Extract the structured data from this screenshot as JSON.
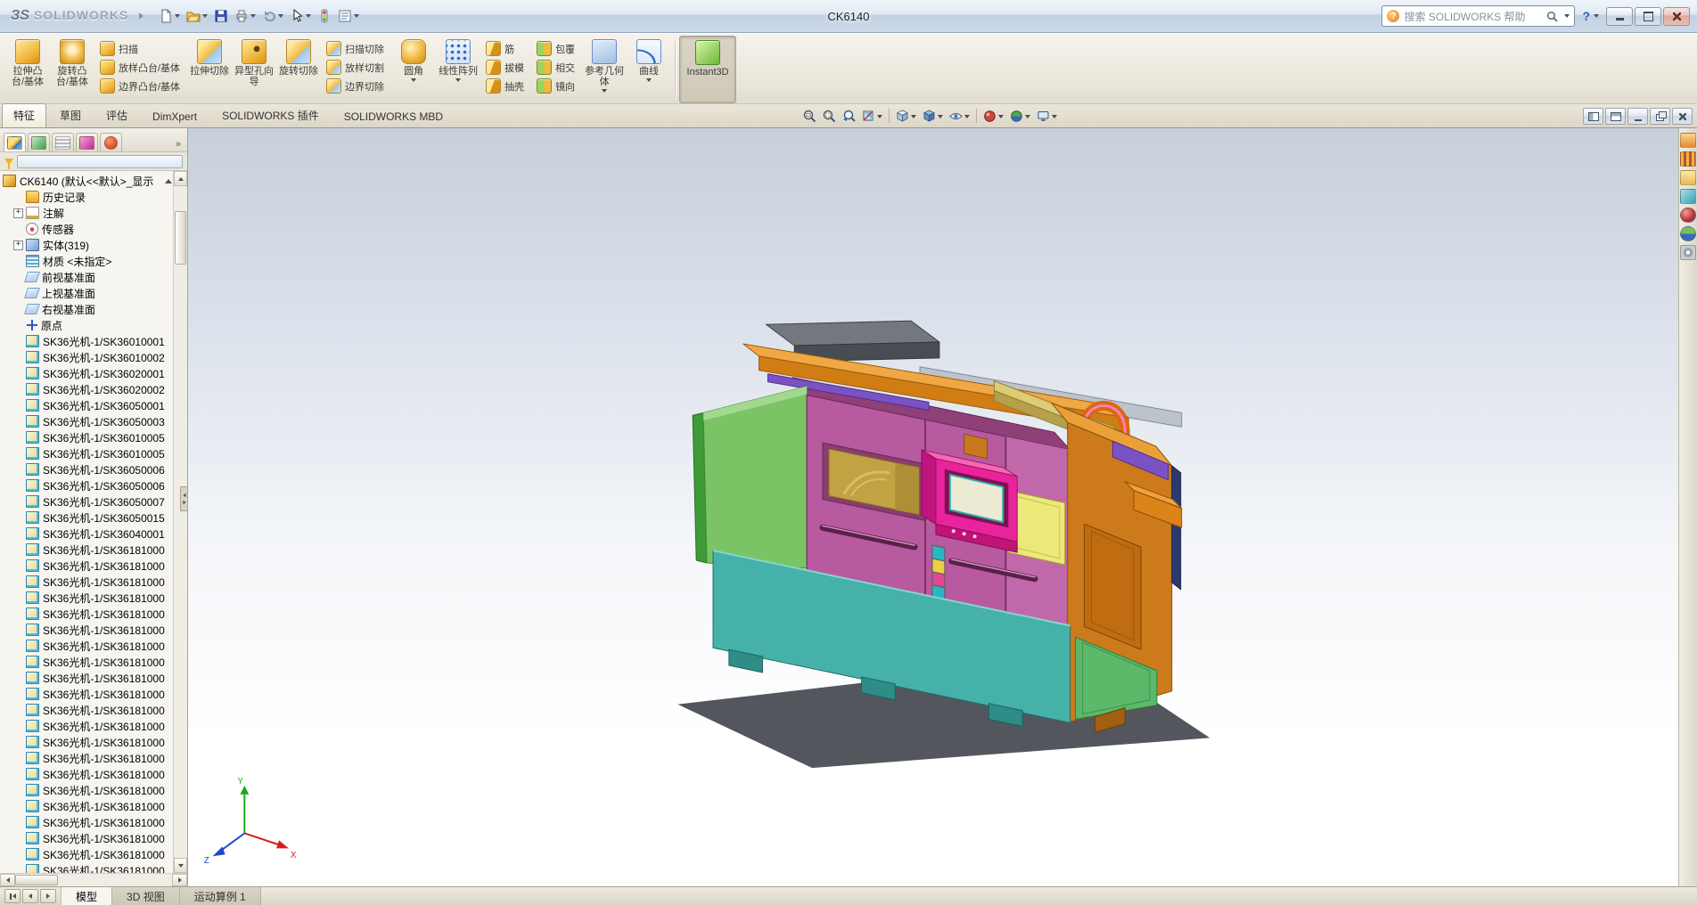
{
  "window": {
    "brand_mark": "ЗS",
    "brand_name": "SOLIDWORKS",
    "title": "CK6140"
  },
  "titlebar": {
    "search_placeholder": "搜索 SOLIDWORKS 帮助",
    "help_glyph": "?",
    "window_icons": [
      "minimize",
      "maximize",
      "close"
    ]
  },
  "quickbar": {
    "icons": [
      "new",
      "open",
      "save",
      "print",
      "undo",
      "select",
      "rebuild",
      "file-properties"
    ]
  },
  "ribbon": {
    "tabs": [
      {
        "label": "特征",
        "active": true
      },
      {
        "label": "草图"
      },
      {
        "label": "评估"
      },
      {
        "label": "DimXpert"
      },
      {
        "label": "SOLIDWORKS 插件"
      },
      {
        "label": "SOLIDWORKS MBD"
      }
    ],
    "large": [
      {
        "label": "拉伸凸台/基体",
        "icon": "extrude-boss"
      },
      {
        "label": "旋转凸台/基体",
        "icon": "revolve-boss"
      },
      {
        "label": "拉伸切除",
        "icon": "extrude-cut"
      },
      {
        "label": "异型孔向导",
        "icon": "hole-wizard"
      },
      {
        "label": "旋转切除",
        "icon": "revolve-cut"
      },
      {
        "label": "圆角",
        "icon": "fillet",
        "dd": true
      },
      {
        "label": "线性阵列",
        "icon": "linear-pattern",
        "dd": true
      },
      {
        "label": "参考几何体",
        "icon": "reference-geometry",
        "dd": true
      },
      {
        "label": "曲线",
        "icon": "curves",
        "dd": true
      },
      {
        "label": "Instant3D",
        "icon": "instant3d",
        "pressed": true
      }
    ],
    "col1": [
      "扫描",
      "放样凸台/基体",
      "边界凸台/基体"
    ],
    "col2": [
      "扫描切除",
      "放样切割",
      "边界切除"
    ],
    "col3": [
      "筋",
      "拔模",
      "抽壳"
    ],
    "col4": [
      "包覆",
      "相交",
      "镜向"
    ]
  },
  "viewbar": {
    "icons": [
      "zoom-fit",
      "zoom-area",
      "previous-view",
      "section-view",
      "view-orientation",
      "display-style",
      "hide-show-items",
      "edit-appearance",
      "apply-scene",
      "view-settings"
    ]
  },
  "pm": {
    "header_icons": [
      "featuremanager-tree",
      "propertymanager",
      "configurationmanager",
      "dimxpertmanager",
      "displaymanager"
    ],
    "overflow_glyph": "»",
    "root": {
      "label": "CK6140 (默认<<默认>_显示"
    },
    "items": [
      {
        "icon": "history",
        "label": "历史记录"
      },
      {
        "icon": "annotations",
        "label": "注解",
        "expand": "+"
      },
      {
        "icon": "sensors",
        "label": "传感器"
      },
      {
        "icon": "bodies",
        "label": "实体(319)",
        "expand": "+"
      },
      {
        "icon": "material",
        "label": "材质 <未指定>"
      },
      {
        "icon": "plane",
        "label": "前视基准面"
      },
      {
        "icon": "plane",
        "label": "上视基准面"
      },
      {
        "icon": "plane",
        "label": "右视基准面"
      },
      {
        "icon": "origin",
        "label": "原点"
      },
      {
        "icon": "body",
        "label": "SK36光机-1/SK36010001"
      },
      {
        "icon": "body",
        "label": "SK36光机-1/SK36010002"
      },
      {
        "icon": "body",
        "label": "SK36光机-1/SK36020001"
      },
      {
        "icon": "body",
        "label": "SK36光机-1/SK36020002"
      },
      {
        "icon": "body",
        "label": "SK36光机-1/SK36050001"
      },
      {
        "icon": "body",
        "label": "SK36光机-1/SK36050003"
      },
      {
        "icon": "body",
        "label": "SK36光机-1/SK36010005"
      },
      {
        "icon": "body",
        "label": "SK36光机-1/SK36010005"
      },
      {
        "icon": "body",
        "label": "SK36光机-1/SK36050006"
      },
      {
        "icon": "body",
        "label": "SK36光机-1/SK36050006"
      },
      {
        "icon": "body",
        "label": "SK36光机-1/SK36050007"
      },
      {
        "icon": "body",
        "label": "SK36光机-1/SK36050015"
      },
      {
        "icon": "body",
        "label": "SK36光机-1/SK36040001"
      },
      {
        "icon": "body",
        "label": "SK36光机-1/SK36181000"
      },
      {
        "icon": "body",
        "label": "SK36光机-1/SK36181000"
      },
      {
        "icon": "body",
        "label": "SK36光机-1/SK36181000"
      },
      {
        "icon": "body",
        "label": "SK36光机-1/SK36181000"
      },
      {
        "icon": "body",
        "label": "SK36光机-1/SK36181000"
      },
      {
        "icon": "body",
        "label": "SK36光机-1/SK36181000"
      },
      {
        "icon": "body",
        "label": "SK36光机-1/SK36181000"
      },
      {
        "icon": "body",
        "label": "SK36光机-1/SK36181000"
      },
      {
        "icon": "body",
        "label": "SK36光机-1/SK36181000"
      },
      {
        "icon": "body",
        "label": "SK36光机-1/SK36181000"
      },
      {
        "icon": "body",
        "label": "SK36光机-1/SK36181000"
      },
      {
        "icon": "body",
        "label": "SK36光机-1/SK36181000"
      },
      {
        "icon": "body",
        "label": "SK36光机-1/SK36181000"
      },
      {
        "icon": "body",
        "label": "SK36光机-1/SK36181000"
      },
      {
        "icon": "body",
        "label": "SK36光机-1/SK36181000"
      },
      {
        "icon": "body",
        "label": "SK36光机-1/SK36181000"
      },
      {
        "icon": "body",
        "label": "SK36光机-1/SK36181000"
      },
      {
        "icon": "body",
        "label": "SK36光机-1/SK36181000"
      },
      {
        "icon": "body",
        "label": "SK36光机-1/SK36181000"
      },
      {
        "icon": "body",
        "label": "SK36光机-1/SK36181000"
      },
      {
        "icon": "body",
        "label": "SK36光机-1/SK36181000"
      }
    ]
  },
  "docbar": {
    "tabs": [
      {
        "label": "模型",
        "active": true
      },
      {
        "label": "3D 视图"
      },
      {
        "label": "运动算例 1"
      }
    ]
  },
  "taskpane": {
    "icons": [
      "solidworks-resources",
      "design-library",
      "file-explorer",
      "view-palette",
      "appearances",
      "scenes",
      "custom-properties"
    ]
  },
  "viewport": {
    "triad": {
      "x": "X",
      "y": "Y",
      "z": "Z"
    }
  },
  "colors": {
    "machine_teal": "#46B1A9",
    "machine_green": "#7AC465",
    "machine_magenta": "#B85AA0",
    "machine_orange": "#CD7A1C",
    "machine_pink": "#E9239B",
    "machine_yellow": "#ECE87A",
    "machine_violet": "#7B52C4",
    "viewport_top": "#C7CFDA",
    "selection_blue": "#2A6AD0"
  }
}
